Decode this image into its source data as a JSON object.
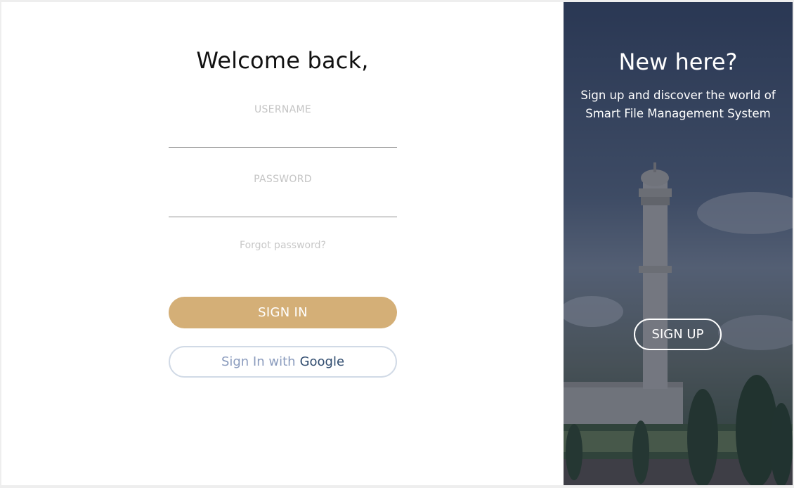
{
  "login": {
    "title": "Welcome back,",
    "username_label": "USERNAME",
    "username_value": "",
    "password_label": "PASSWORD",
    "password_value": "",
    "forgot_label": "Forgot password?",
    "signin_label": "SIGN IN",
    "google_prefix": "Sign In with",
    "google_brand": "Google"
  },
  "signup_panel": {
    "title": "New here?",
    "text": "Sign up and discover the world of Smart File Management System",
    "signup_label": "SIGN UP"
  },
  "colors": {
    "accent": "#d4af77",
    "google_border": "#d1dae6",
    "google_text": "#8a9bbd",
    "google_brand": "#2f4b6e"
  }
}
